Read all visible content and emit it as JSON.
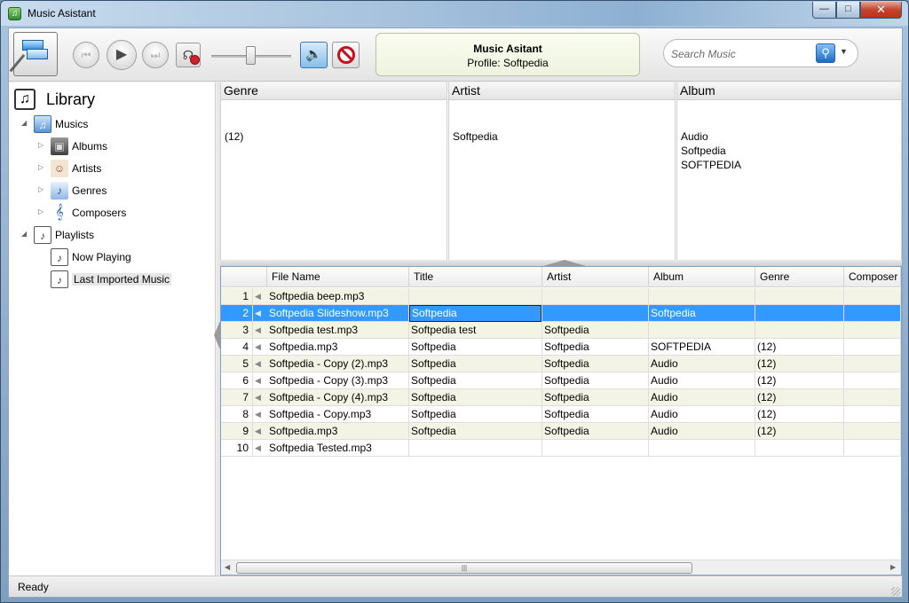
{
  "window": {
    "title": "Music Asistant",
    "minimize": "—",
    "maximize": "□",
    "close": "✕"
  },
  "toolbar": {
    "prev_glyph": "⏮",
    "play_glyph": "▶",
    "next_glyph": "⏭",
    "volume_glyph": "🔈",
    "volume_level": 0.5,
    "icons": {
      "logo": "playlist-edit-icon",
      "prev": "previous-track-icon",
      "play": "play-icon",
      "next": "next-track-icon",
      "mute": "speaker-mute-icon",
      "volume": "speaker-icon",
      "stop": "stop-sign-icon"
    }
  },
  "info": {
    "title": "Music Asitant",
    "profile": "Profile: Softpedia"
  },
  "search": {
    "placeholder": "Search Music",
    "button_glyph": "⚲",
    "dropdown_glyph": "▼"
  },
  "library": {
    "title": "Library",
    "icon_glyph": "♫",
    "musics": {
      "label": "Musics",
      "expanded_glyph": "◢",
      "children": [
        {
          "label": "Albums",
          "glyph": "▣",
          "arrow": "▷"
        },
        {
          "label": "Artists",
          "glyph": "☺",
          "arrow": "▷"
        },
        {
          "label": "Genres",
          "glyph": "♪",
          "arrow": "▷"
        },
        {
          "label": "Composers",
          "glyph": "𝄞",
          "arrow": "▷"
        }
      ]
    },
    "playlists": {
      "label": "Playlists",
      "expanded_glyph": "◢",
      "children": [
        {
          "label": "Now Playing",
          "glyph": "♪"
        },
        {
          "label": "Last Imported Music",
          "glyph": "♪"
        }
      ]
    }
  },
  "filters": {
    "genre": {
      "header": "Genre",
      "items": [
        "(12)"
      ]
    },
    "artist": {
      "header": "Artist",
      "items": [
        "Softpedia"
      ]
    },
    "album": {
      "header": "Album",
      "items": [
        "Audio",
        "Softpedia",
        "SOFTPEDIA"
      ]
    }
  },
  "grid": {
    "columns": [
      "File Name",
      "Title",
      "Artist",
      "Album",
      "Genre",
      "Composer"
    ],
    "selected_row": 2,
    "speaker_glyph": "◀",
    "rows": [
      {
        "n": "1",
        "file": "Softpedia beep.mp3",
        "title": "",
        "artist": "",
        "album": "",
        "genre": ""
      },
      {
        "n": "2",
        "file": "Softpedia Slideshow.mp3",
        "title": "Softpedia",
        "artist": "",
        "album": "Softpedia",
        "genre": ""
      },
      {
        "n": "3",
        "file": "Softpedia test.mp3",
        "title": "Softpedia test",
        "artist": "Softpedia",
        "album": "",
        "genre": ""
      },
      {
        "n": "4",
        "file": "Softpedia.mp3",
        "title": "Softpedia",
        "artist": "Softpedia",
        "album": "SOFTPEDIA",
        "genre": "(12)"
      },
      {
        "n": "5",
        "file": "Softpedia - Copy (2).mp3",
        "title": "Softpedia",
        "artist": "Softpedia",
        "album": "Audio",
        "genre": "(12)"
      },
      {
        "n": "6",
        "file": "Softpedia - Copy (3).mp3",
        "title": "Softpedia",
        "artist": "Softpedia",
        "album": "Audio",
        "genre": "(12)"
      },
      {
        "n": "7",
        "file": "Softpedia - Copy (4).mp3",
        "title": "Softpedia",
        "artist": "Softpedia",
        "album": "Audio",
        "genre": "(12)"
      },
      {
        "n": "8",
        "file": "Softpedia - Copy.mp3",
        "title": "Softpedia",
        "artist": "Softpedia",
        "album": "Audio",
        "genre": "(12)"
      },
      {
        "n": "9",
        "file": "Softpedia.mp3",
        "title": "Softpedia",
        "artist": "Softpedia",
        "album": "Audio",
        "genre": "(12)"
      },
      {
        "n": "10",
        "file": "Softpedia Tested.mp3",
        "title": "",
        "artist": "",
        "album": "",
        "genre": ""
      }
    ]
  },
  "scroll": {
    "left_glyph": "◀",
    "right_glyph": "▶",
    "grip_glyph": "|||"
  },
  "status": {
    "text": "Ready"
  }
}
